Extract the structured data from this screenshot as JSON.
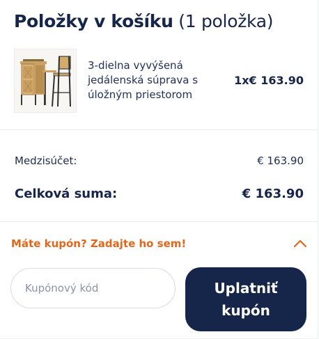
{
  "cart": {
    "title": "Položky v košíku",
    "count_label": "(1 položka)"
  },
  "item": {
    "name": "3-dielna vyvýšená jedálenská súprava s úložným priestorom",
    "price": "1x€ 163.90",
    "image_icon": "dining-set-product-image"
  },
  "summary": {
    "subtotal_label": "Medzisúčet:",
    "subtotal_value": "€ 163.90",
    "total_label": "Celková suma:",
    "total_value": "€ 163.90"
  },
  "coupon": {
    "toggle_label": "Máte kupón? Zadajte ho sem!",
    "toggle_icon": "chevron-up-icon",
    "input_placeholder": "Kupónový kód",
    "input_value": "",
    "apply_label": "Uplatniť kupón"
  },
  "colors": {
    "navy": "#16254a",
    "accent_orange": "#e4661b",
    "divider": "#e8eaef"
  }
}
